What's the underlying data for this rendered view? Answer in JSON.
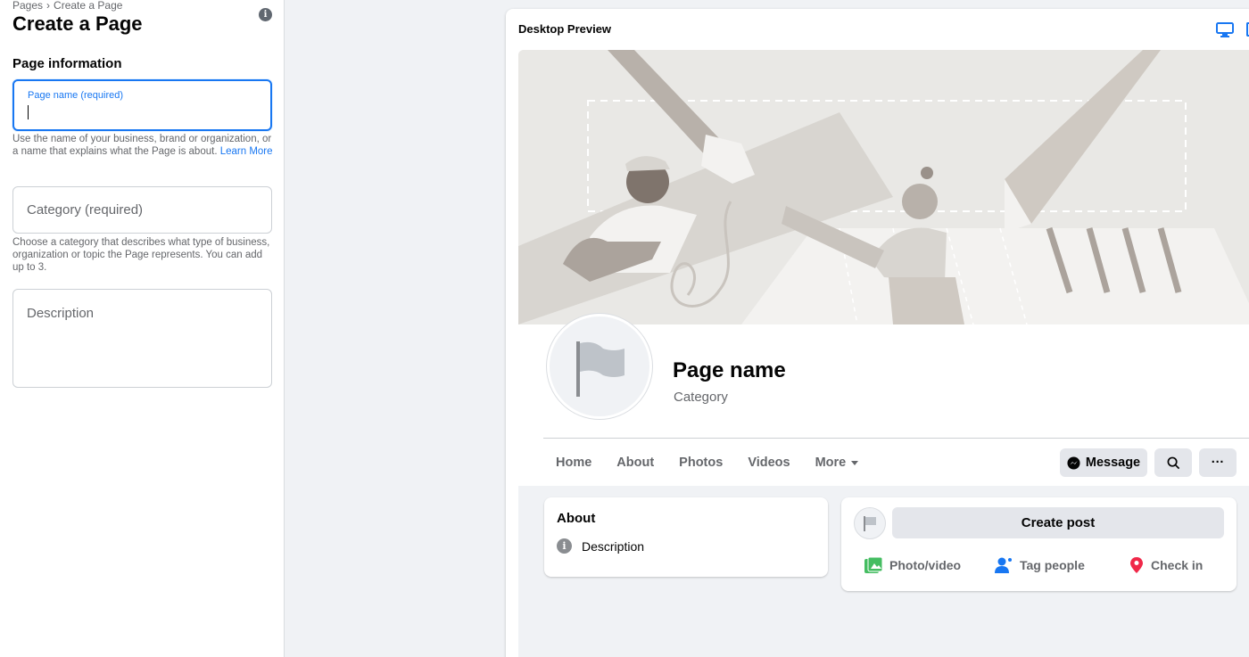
{
  "sidebar": {
    "breadcrumb": [
      "Pages",
      "Create a Page"
    ],
    "breadcrumb_sep": "›",
    "title": "Create a Page",
    "info_icon": "i",
    "section_title": "Page information",
    "page_name": {
      "label": "Page name (required)",
      "value": ""
    },
    "page_name_hint": "Use the name of your business, brand or organization, or a name that explains what the Page is about.",
    "learn_more": "Learn More",
    "category_placeholder": "Category (required)",
    "category_hint": "Choose a category that describes what type of business, organization or topic the Page represents. You can add up to 3.",
    "description_placeholder": "Description"
  },
  "preview": {
    "title": "Desktop Preview",
    "page_name": "Page name",
    "category": "Category",
    "nav": [
      "Home",
      "About",
      "Photos",
      "Videos",
      "More"
    ],
    "message_button": "Message",
    "more_button": "···",
    "about": {
      "title": "About",
      "description": "Description",
      "icon": "i"
    },
    "create_post": "Create post",
    "actions": [
      "Photo/video",
      "Tag people",
      "Check in"
    ]
  },
  "colors": {
    "accent": "#1877f2",
    "background": "#f0f2f5",
    "photo_green": "#45bd62",
    "checkin_red": "#f02849"
  }
}
